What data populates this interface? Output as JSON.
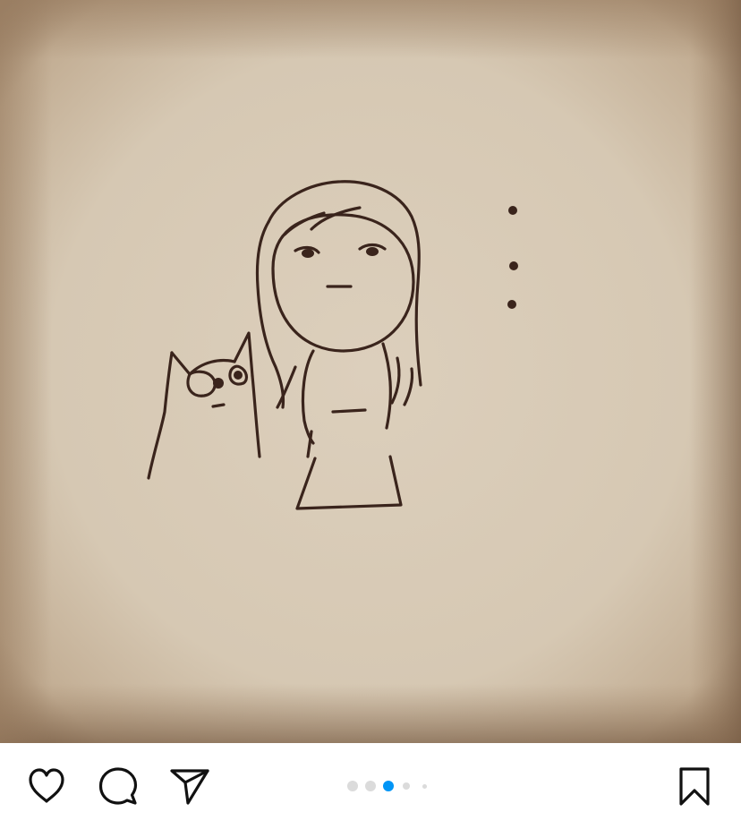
{
  "post": {
    "image": {
      "description_icon": "doodle-girl-with-cat-icon",
      "paper_color": "#d8cab6",
      "ink_color": "#3a241c"
    },
    "actions": {
      "like_icon": "heart-icon",
      "comment_icon": "comment-bubble-icon",
      "share_icon": "paper-plane-icon",
      "save_icon": "bookmark-icon"
    },
    "carousel": {
      "total": 5,
      "active_index": 2,
      "active_color": "#0095f6",
      "inactive_color": "#dbdbdb"
    }
  }
}
